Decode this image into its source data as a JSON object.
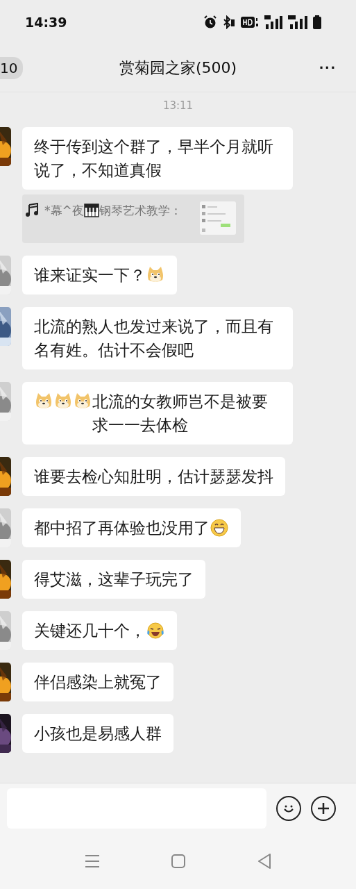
{
  "status_bar": {
    "time": "14:39"
  },
  "header": {
    "unread_badge": "10",
    "title": "赏菊园之家(500)",
    "more": "···"
  },
  "timestamp": "13:11",
  "messages": [
    {
      "avatar": {
        "kind": "picture"
      },
      "parts": [
        {
          "kind": "text",
          "text": "终于传到这个群了，早半个月就听说了，不知道真假"
        }
      ],
      "quote": {
        "parts": [
          {
            "kind": "note"
          },
          {
            "kind": "text",
            "text": "*幕^夜"
          },
          {
            "kind": "piano"
          },
          {
            "kind": "text",
            "text": "钢琴艺术教学："
          }
        ],
        "thumbnail": {
          "kind": "picture"
        }
      }
    },
    {
      "avatar": {
        "kind": "picture"
      },
      "parts": [
        {
          "kind": "text",
          "text": "谁来证实一下？"
        },
        {
          "kind": "doge"
        }
      ]
    },
    {
      "avatar": {
        "kind": "picture"
      },
      "parts": [
        {
          "kind": "text",
          "text": "北流的熟人也发过来说了，而且有名有姓。估计不会假吧"
        }
      ]
    },
    {
      "avatar": {
        "kind": "picture"
      },
      "parts": [
        {
          "kind": "doge"
        },
        {
          "kind": "doge"
        },
        {
          "kind": "doge"
        },
        {
          "kind": "text",
          "text": "北流的女教师岂不是被要求一一去体检"
        }
      ]
    },
    {
      "avatar": {
        "kind": "picture"
      },
      "parts": [
        {
          "kind": "text",
          "text": "谁要去检心知肚明，估计瑟瑟发抖"
        }
      ]
    },
    {
      "avatar": {
        "kind": "picture"
      },
      "parts": [
        {
          "kind": "text",
          "text": "都中招了再体验也没用了"
        },
        {
          "kind": "grin"
        }
      ]
    },
    {
      "avatar": {
        "kind": "picture"
      },
      "parts": [
        {
          "kind": "text",
          "text": "得艾滋，这辈子玩完了"
        }
      ]
    },
    {
      "avatar": {
        "kind": "picture"
      },
      "parts": [
        {
          "kind": "text",
          "text": "关键还几十个，"
        },
        {
          "kind": "tears"
        }
      ]
    },
    {
      "avatar": {
        "kind": "picture"
      },
      "parts": [
        {
          "kind": "text",
          "text": "伴侣感染上就冤了"
        }
      ]
    },
    {
      "avatar": {
        "kind": "picture"
      },
      "parts": [
        {
          "kind": "text",
          "text": "小孩也是易感人群"
        }
      ]
    }
  ]
}
